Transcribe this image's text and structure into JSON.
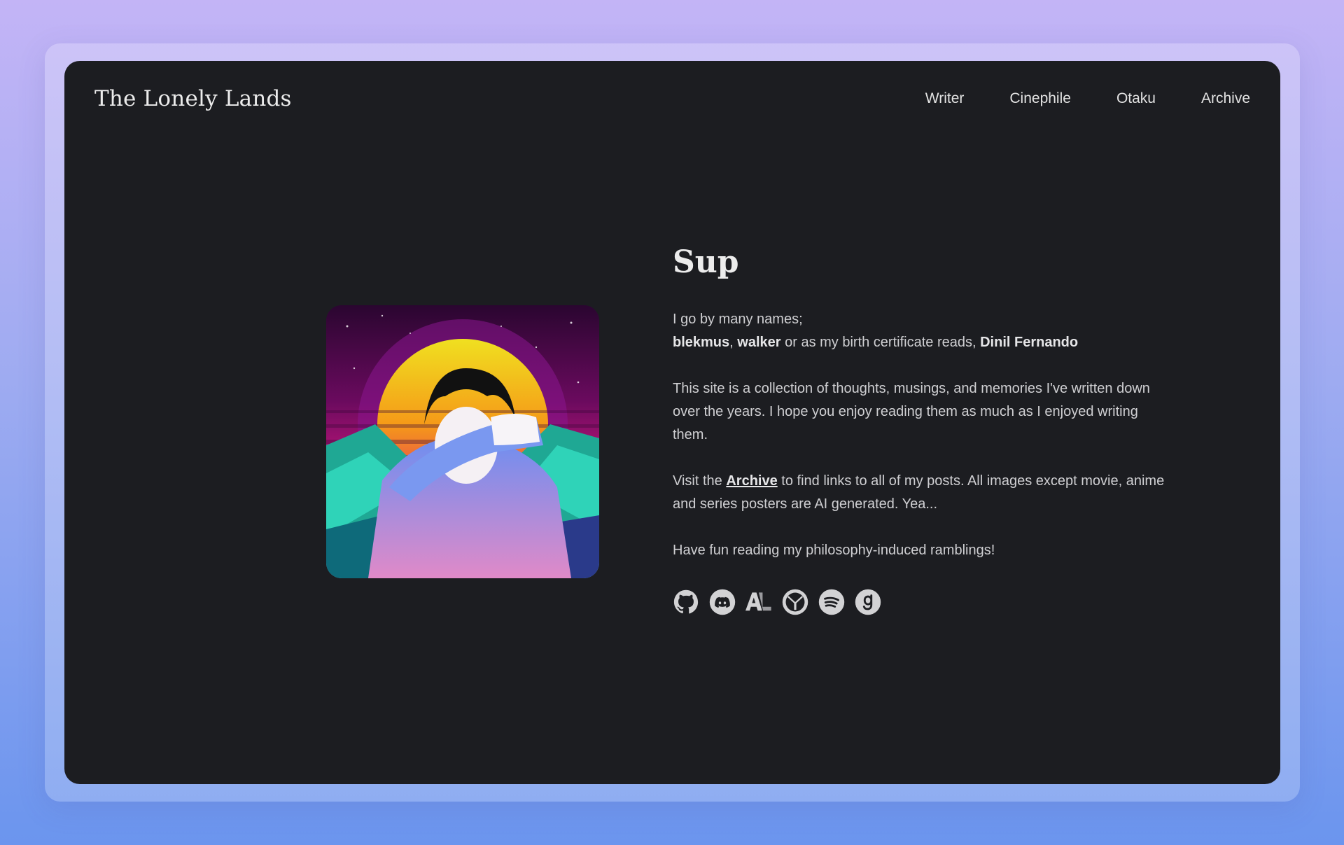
{
  "site": {
    "title": "The Lonely Lands"
  },
  "nav": {
    "items": [
      "Writer",
      "Cinephile",
      "Otaku",
      "Archive"
    ]
  },
  "hero": {
    "heading": "Sup",
    "intro_line": "I go by many names;",
    "alias1": "blekmus",
    "sep": ",",
    "alias2": "walker",
    "mid_text": "or as my birth certificate reads,",
    "real_name": "Dinil Fernando",
    "paragraph2": "This site is a collection of thoughts, musings, and memories I've written down over the years. I hope you enjoy reading them as much as I enjoyed writing them.",
    "p3_pre": "Visit the",
    "p3_link": "Archive",
    "p3_post": "to find links to all of my posts. All images except movie, anime and series posters are AI generated. Yea...",
    "paragraph4": "Have fun reading my philosophy-induced ramblings!"
  },
  "socials": [
    "github-icon",
    "discord-icon",
    "anilist-icon",
    "letterboxd-icon",
    "spotify-icon",
    "goodreads-icon"
  ],
  "colors": {
    "background_window": "#1c1d21",
    "text": "#cfcfd2",
    "heading": "#ececec"
  }
}
